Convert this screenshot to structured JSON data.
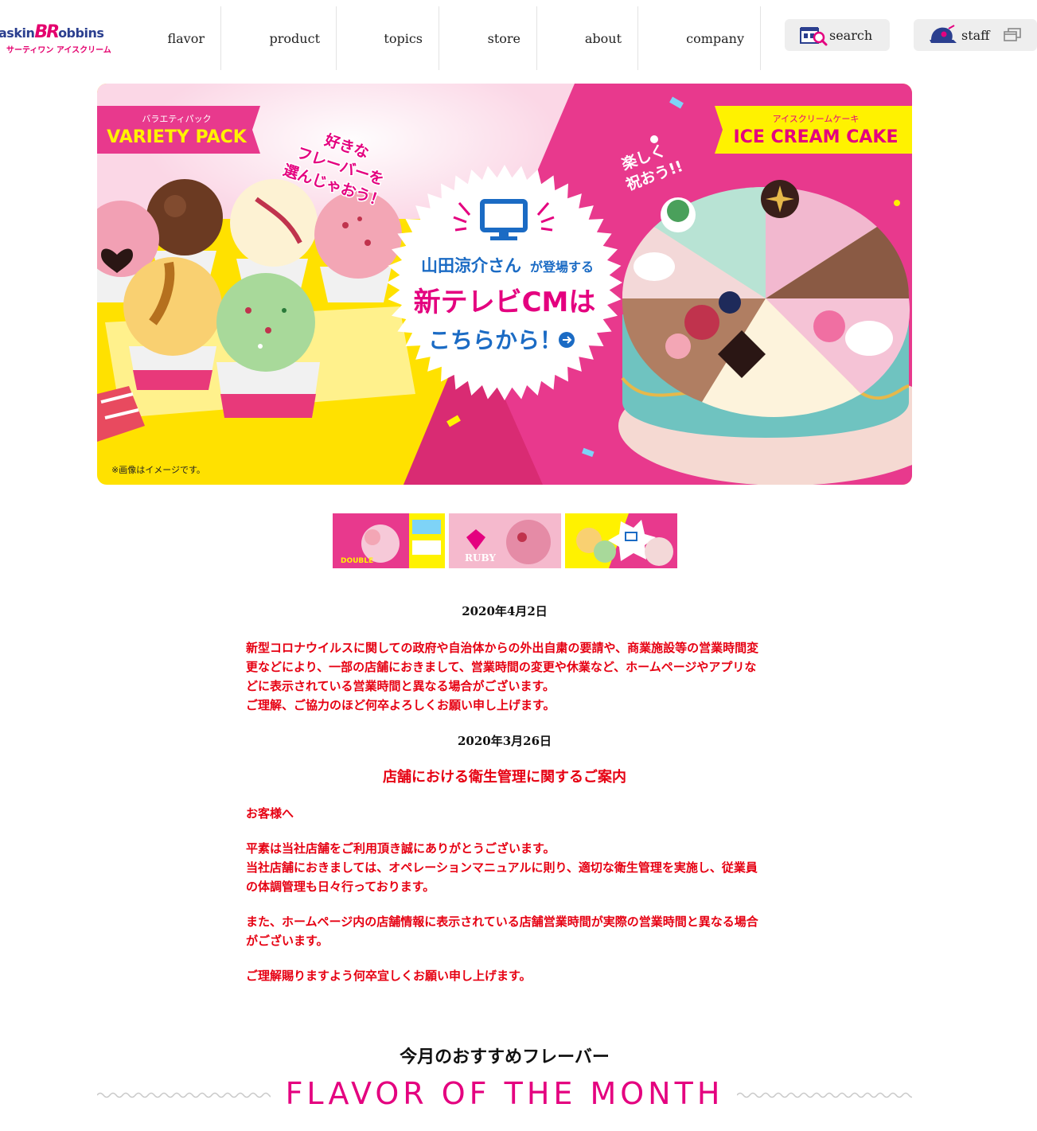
{
  "brand": {
    "logo_text_left": "askin",
    "logo_text_mid": "BR",
    "logo_text_right": "obbins",
    "logo_sub": "サーティワン アイスクリーム"
  },
  "nav": {
    "items": [
      "flavor",
      "product",
      "topics",
      "store",
      "about",
      "company"
    ]
  },
  "header_actions": {
    "search_label": "search",
    "staff_label": "staff"
  },
  "hero": {
    "left_tag_jp": "バラエティパック",
    "left_tag_en": "VARIETY PACK",
    "left_callout": [
      "好きな",
      "フレーバーを",
      "選んじゃおう！"
    ],
    "right_tag_jp": "アイスクリームケーキ",
    "right_tag_en": "ICE CREAM CAKE",
    "right_callout": [
      "楽しく",
      "祝おう!!"
    ],
    "center_line1a": "山田涼介さん",
    "center_line1b": "が登場する",
    "center_line2": "新テレビCMは",
    "center_line3": "こちらから！",
    "note": "※画像はイメージです。",
    "colors": {
      "yellow": "#ffe100",
      "pink": "#e8398d",
      "hotpink": "#e4007f",
      "navy": "#1b6bc4"
    }
  },
  "carousel": {
    "thumbs": [
      "thumb-double-scoop",
      "thumb-ruby",
      "thumb-tv-cm"
    ]
  },
  "news": [
    {
      "date": "2020年4月2日",
      "paragraphs": [
        "新型コロナウイルスに関しての政府や自治体からの外出自粛の要請や、商業施設等の営業時間変更などにより、一部の店舗におきまして、営業時間の変更や休業など、ホームページやアプリなどに表示されている営業時間と異なる場合がございます。",
        "ご理解、ご協力のほど何卒よろしくお願い申し上げます。"
      ]
    },
    {
      "date": "2020年3月26日",
      "title": "店舗における衛生管理に関するご案内",
      "greeting": "お客様へ",
      "para1": "平素は当社店舗をご利用頂き誠にありがとうございます。",
      "para2": "当社店舗におきましては、オペレーションマニュアルに則り、適切な衛生管理を実施し、従業員の体調管理も日々行っております。",
      "para3": "また、ホームページ内の店舗情報に表示されている店舗営業時間が実際の営業時間と異なる場合がございます。",
      "para4": "ご理解賜りますよう何卒宜しくお願い申し上げます。"
    }
  ],
  "flavor_of_month": {
    "title_jp": "今月のおすすめフレーバー",
    "title_en": "FLAVOR OF THE MONTH"
  }
}
